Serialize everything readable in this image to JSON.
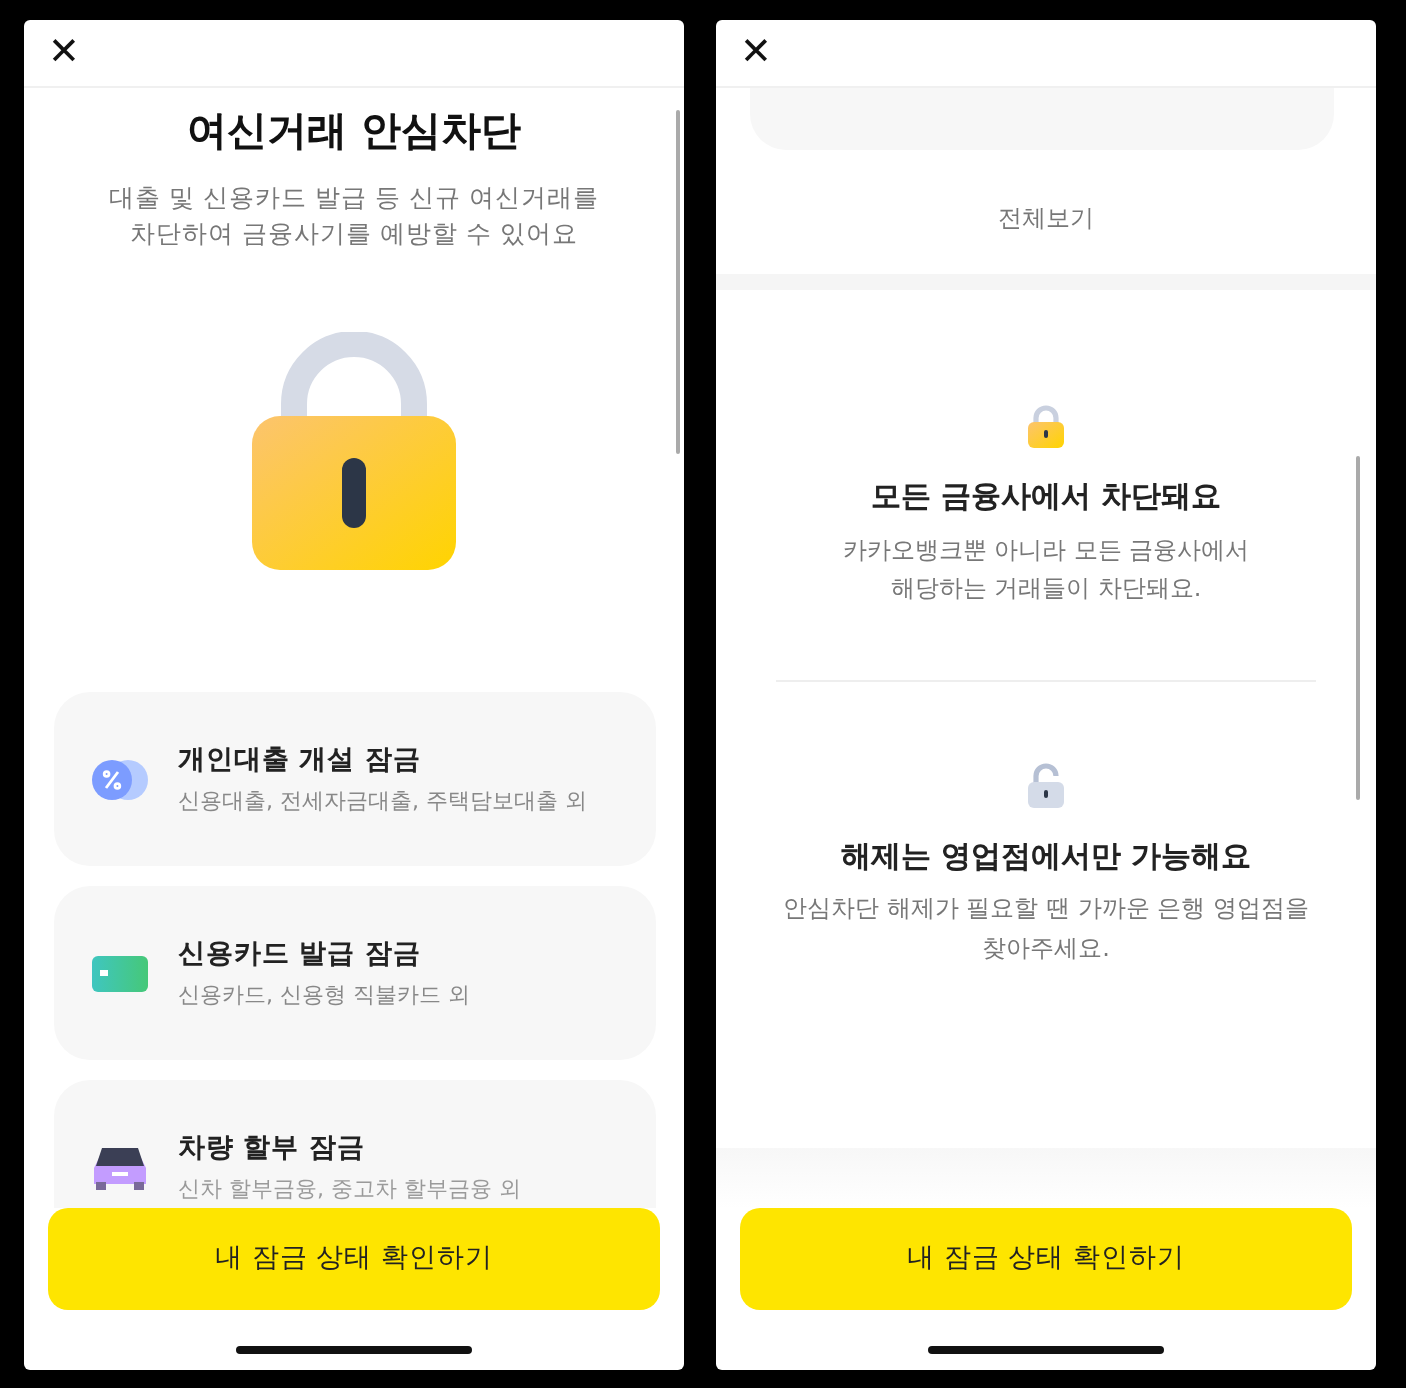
{
  "screens": [
    {
      "close": "✕",
      "title": "여신거래 안심차단",
      "description": "대출 및 신용카드 발급 등 신규 여신거래를\n차단하여 금융사기를 예방할 수 있어요",
      "cards": [
        {
          "kind": "loan",
          "title": "개인대출 개설 잠금",
          "subtitle": "신용대출, 전세자금대출, 주택담보대출 외",
          "faded": false
        },
        {
          "kind": "card",
          "title": "신용카드 발급 잠금",
          "subtitle": "신용카드, 신용형 직불카드 외",
          "faded": false
        },
        {
          "kind": "car",
          "title": "차량 할부 잠금",
          "subtitle": "신차 할부금융, 중고차 할부금융 외",
          "faded": true
        }
      ],
      "button": "내 잠금 상태 확인하기"
    },
    {
      "close": "✕",
      "view_all": "전체보기",
      "sections": [
        {
          "kind": "locked",
          "title": "모든 금융사에서 차단돼요",
          "text": "카카오뱅크뿐 아니라 모든 금융사에서\n해당하는 거래들이 차단돼요."
        },
        {
          "kind": "unlocked",
          "title": "해제는 영업점에서만 가능해요",
          "text": "안심차단 해제가 필요할 땐 가까운 은행 영업점을\n찾아주세요."
        }
      ],
      "button": "내 잠금 상태 확인하기"
    }
  ]
}
